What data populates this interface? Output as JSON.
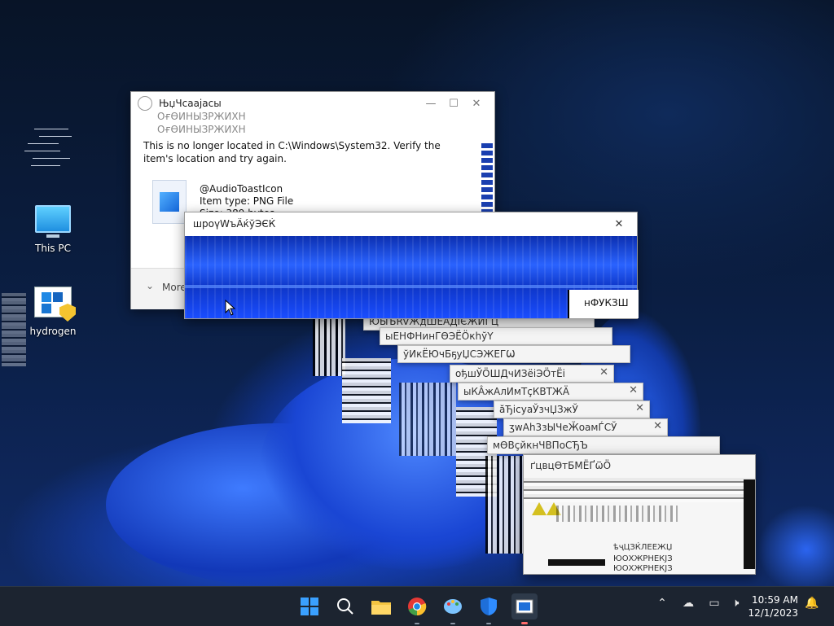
{
  "desktop": {
    "icons": [
      {
        "label": "This PC"
      },
      {
        "label": "hydrogen"
      }
    ]
  },
  "error_dialog": {
    "title": "ЊџЧсаајасы",
    "ghost_titles": [
      "ОғӨИНЫЗРЖИХН",
      "ОғӨИНЫЗРЖИХН"
    ],
    "message": "This is no longer located in C:\\Windows\\System32. Verify the item's location and try again.",
    "file_name": "@AudioToastIcon",
    "file_type": "Item type: PNG File",
    "file_size": "Size: 389 bytes",
    "more_label": "More"
  },
  "front_window": {
    "title": "шроүWъÄќўЭЄЌ",
    "corner_text": "нФУКЗШ"
  },
  "stacked_windows": [
    {
      "title": "ЮЫЪRVЖдШЕАДІЄЖИГЦ"
    },
    {
      "title": "ыЕНФНинГӨЭЁӦкhўҮ"
    },
    {
      "title": "ўИкЁЮчБҕуЏСЭЖЕГѠ"
    },
    {
      "title": "ођшЎӦШДчИЗёіЭӦтЁі"
    },
    {
      "title": "ыКÂжАлИмТҫКВТЖӒ"
    },
    {
      "title": "ӑЂісуаЎзчЏЗжЎ"
    },
    {
      "title": "ӡwАh3зЫЧеӁоамЃСЎ"
    },
    {
      "title": "мӨВҫйкнЧВПоСЂЪ"
    },
    {
      "title": "ґцвцӨтБМЁҐѿӦ"
    }
  ],
  "stack_bottom_labels": [
    "ѣҷЦЗЌЛЕЕЖЏ",
    "ЮОХЖРНЕКЈЗ",
    "ЮОХЖРНЕКЈЗ"
  ],
  "taskbar": {
    "apps": [
      "start",
      "search",
      "file-explorer",
      "chrome",
      "paint",
      "defender",
      "active-app"
    ],
    "time": "10:59 AM",
    "date": "12/1/2023"
  }
}
